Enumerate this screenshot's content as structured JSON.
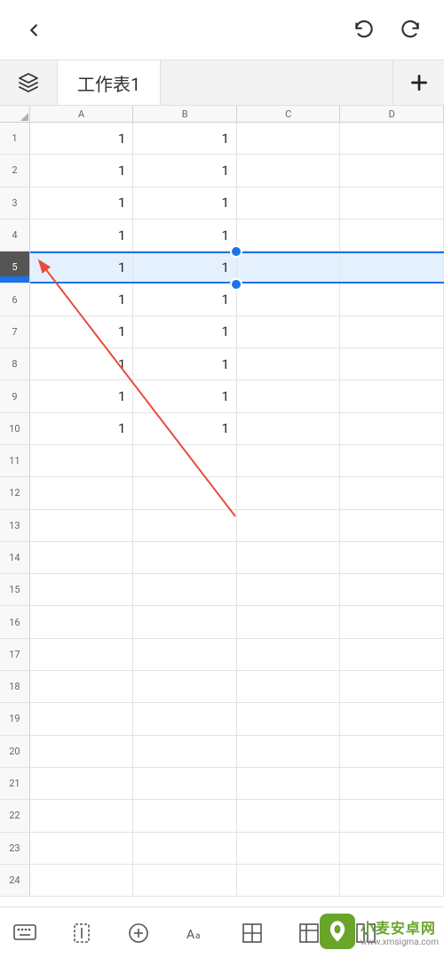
{
  "sheet": {
    "name": "工作表1",
    "columns": [
      "A",
      "B",
      "C",
      "D"
    ],
    "selected_row_index": 4,
    "rows": [
      {
        "n": 1,
        "cells": [
          "1",
          "1",
          "",
          ""
        ]
      },
      {
        "n": 2,
        "cells": [
          "1",
          "1",
          "",
          ""
        ]
      },
      {
        "n": 3,
        "cells": [
          "1",
          "1",
          "",
          ""
        ]
      },
      {
        "n": 4,
        "cells": [
          "1",
          "1",
          "",
          ""
        ]
      },
      {
        "n": 5,
        "cells": [
          "1",
          "1",
          "",
          ""
        ]
      },
      {
        "n": 6,
        "cells": [
          "1",
          "1",
          "",
          ""
        ]
      },
      {
        "n": 7,
        "cells": [
          "1",
          "1",
          "",
          ""
        ]
      },
      {
        "n": 8,
        "cells": [
          "1",
          "1",
          "",
          ""
        ]
      },
      {
        "n": 9,
        "cells": [
          "1",
          "1",
          "",
          ""
        ]
      },
      {
        "n": 10,
        "cells": [
          "1",
          "1",
          "",
          ""
        ]
      },
      {
        "n": 11,
        "cells": [
          "",
          "",
          "",
          ""
        ]
      },
      {
        "n": 12,
        "cells": [
          "",
          "",
          "",
          ""
        ]
      },
      {
        "n": 13,
        "cells": [
          "",
          "",
          "",
          ""
        ]
      },
      {
        "n": 14,
        "cells": [
          "",
          "",
          "",
          ""
        ]
      },
      {
        "n": 15,
        "cells": [
          "",
          "",
          "",
          ""
        ]
      },
      {
        "n": 16,
        "cells": [
          "",
          "",
          "",
          ""
        ]
      },
      {
        "n": 17,
        "cells": [
          "",
          "",
          "",
          ""
        ]
      },
      {
        "n": 18,
        "cells": [
          "",
          "",
          "",
          ""
        ]
      },
      {
        "n": 19,
        "cells": [
          "",
          "",
          "",
          ""
        ]
      },
      {
        "n": 20,
        "cells": [
          "",
          "",
          "",
          ""
        ]
      },
      {
        "n": 21,
        "cells": [
          "",
          "",
          "",
          ""
        ]
      },
      {
        "n": 22,
        "cells": [
          "",
          "",
          "",
          ""
        ]
      },
      {
        "n": 23,
        "cells": [
          "",
          "",
          "",
          ""
        ]
      },
      {
        "n": 24,
        "cells": [
          "",
          "",
          "",
          ""
        ]
      }
    ]
  },
  "watermark": {
    "title": "小麦安卓网",
    "url": "www.xmsigma.com"
  }
}
